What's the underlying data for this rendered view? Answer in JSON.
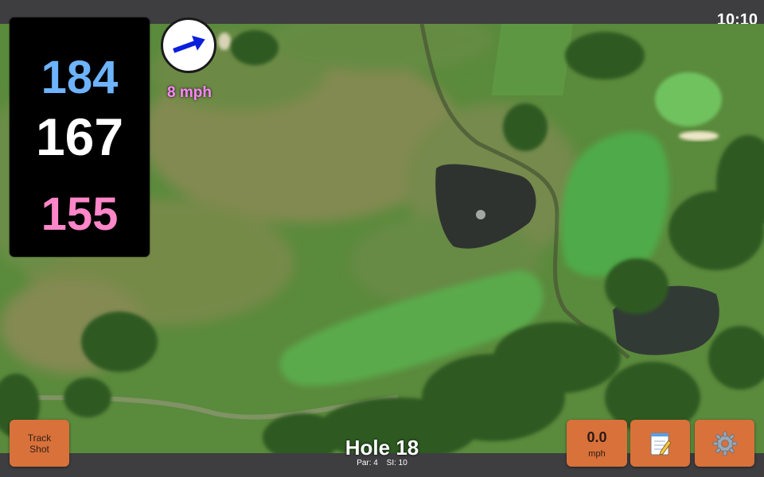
{
  "status_bar": {
    "time": "10:10"
  },
  "distances": {
    "back": "184",
    "middle": "167",
    "front": "155"
  },
  "wind": {
    "speed": "8 mph",
    "icon": "arrow-icon",
    "arrow_color": "#0a1fdc"
  },
  "buttons": {
    "track_shot": "Track\nShot",
    "speed_value": "0.0",
    "speed_unit": "mph",
    "notes_icon": "notepad-icon",
    "settings_icon": "gear-icon"
  },
  "hole": {
    "title": "Hole 18",
    "par": "Par: 4",
    "si": "SI: 10"
  },
  "colors": {
    "back_distance": "#6db3ff",
    "middle_distance": "#ffffff",
    "front_distance": "#ff86c8",
    "wind_text": "#ff86ff",
    "button_bg": "#d9713b",
    "bar_bg": "#3e3e40"
  }
}
